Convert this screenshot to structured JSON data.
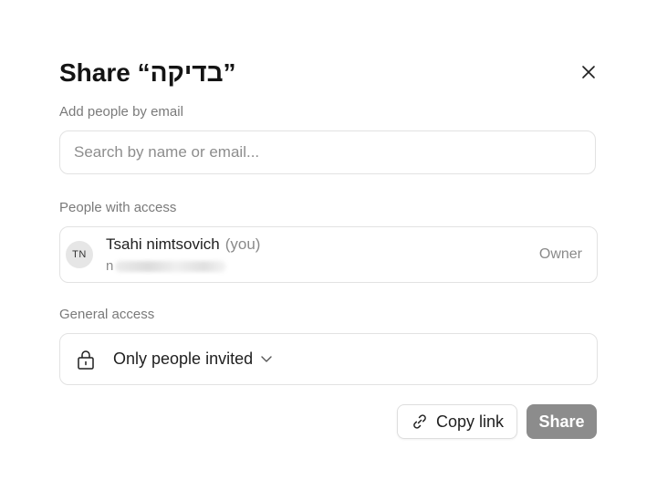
{
  "dialog": {
    "title": "Share “בדיקה”"
  },
  "add_people": {
    "label": "Add people by email",
    "placeholder": "Search by name or email..."
  },
  "people_access": {
    "label": "People with access",
    "people": [
      {
        "initials": "TN",
        "name": "Tsahi nimtsovich",
        "you_tag": "(you)",
        "email_visible": "n",
        "role": "Owner"
      }
    ]
  },
  "general_access": {
    "label": "General access",
    "selected_option": "Only people invited",
    "icon": "lock-icon"
  },
  "footer": {
    "copy_link_label": "Copy link",
    "share_label": "Share",
    "share_color": "#8c8c8c"
  }
}
